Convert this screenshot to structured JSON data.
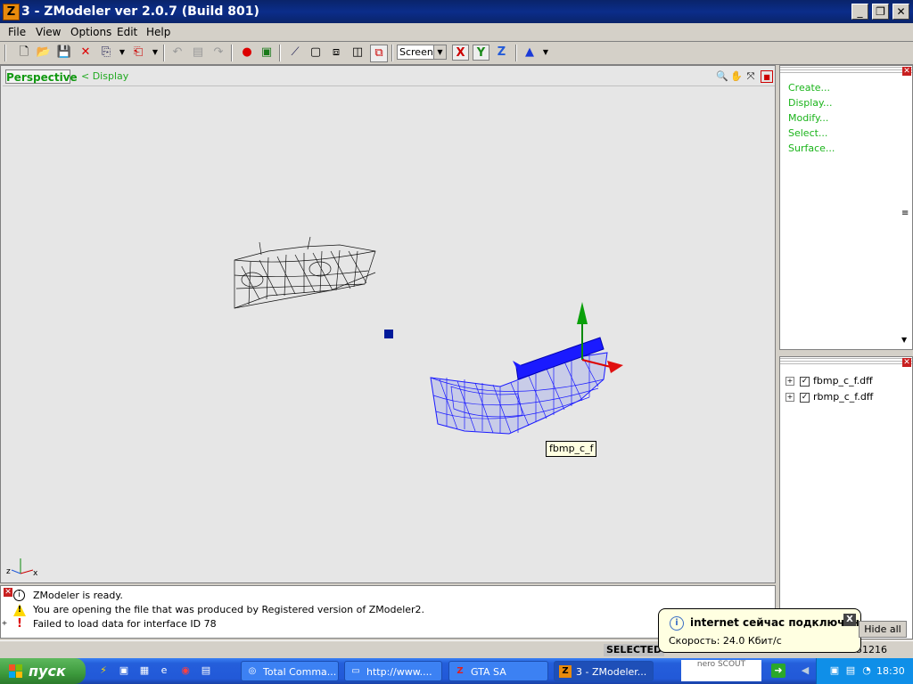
{
  "window": {
    "title": "3 - ZModeler ver 2.0.7 (Build 801)",
    "app_icon": "Z"
  },
  "menu": [
    "File",
    "View",
    "Options",
    "Edit",
    "Help"
  ],
  "toolbar": {
    "view_mode": "Screen",
    "axes": [
      "X",
      "Y",
      "Z"
    ]
  },
  "viewport": {
    "tab": "Perspective",
    "display_link": "<  Display",
    "object_tooltip": "fbmp_c_f",
    "axis_labels": [
      "z",
      "x"
    ]
  },
  "commands_panel": {
    "items": [
      "Create...",
      "Display...",
      "Modify...",
      "Select...",
      "Surface..."
    ]
  },
  "object_tree": {
    "items": [
      "fbmp_c_f.dff",
      "rbmp_c_f.dff"
    ]
  },
  "log": {
    "rows": [
      {
        "icon": "info-icon",
        "text": "ZModeler is ready."
      },
      {
        "icon": "warning-icon",
        "text": "You are opening the file that was produced by Registered version of ZModeler2."
      },
      {
        "icon": "error-icon",
        "text": "Failed to load data for interface ID 78"
      }
    ]
  },
  "status": {
    "selected": "SELECTED",
    "count": "51216"
  },
  "balloon": {
    "title": "internet сейчас подключен",
    "body": "Скорость: 24.0 Кбит/с",
    "button": "Hide all"
  },
  "taskbar": {
    "start": "пуск",
    "tasks": [
      "Total Comma...",
      "http://www....",
      "GTA SA",
      "3 - ZModeler..."
    ],
    "nero": "nero SCOUT",
    "clock": "18:30"
  },
  "colors": {
    "accent_green": "#1ab41a",
    "selected_mesh": "#0000ff",
    "titlebar": "#0a246a"
  }
}
